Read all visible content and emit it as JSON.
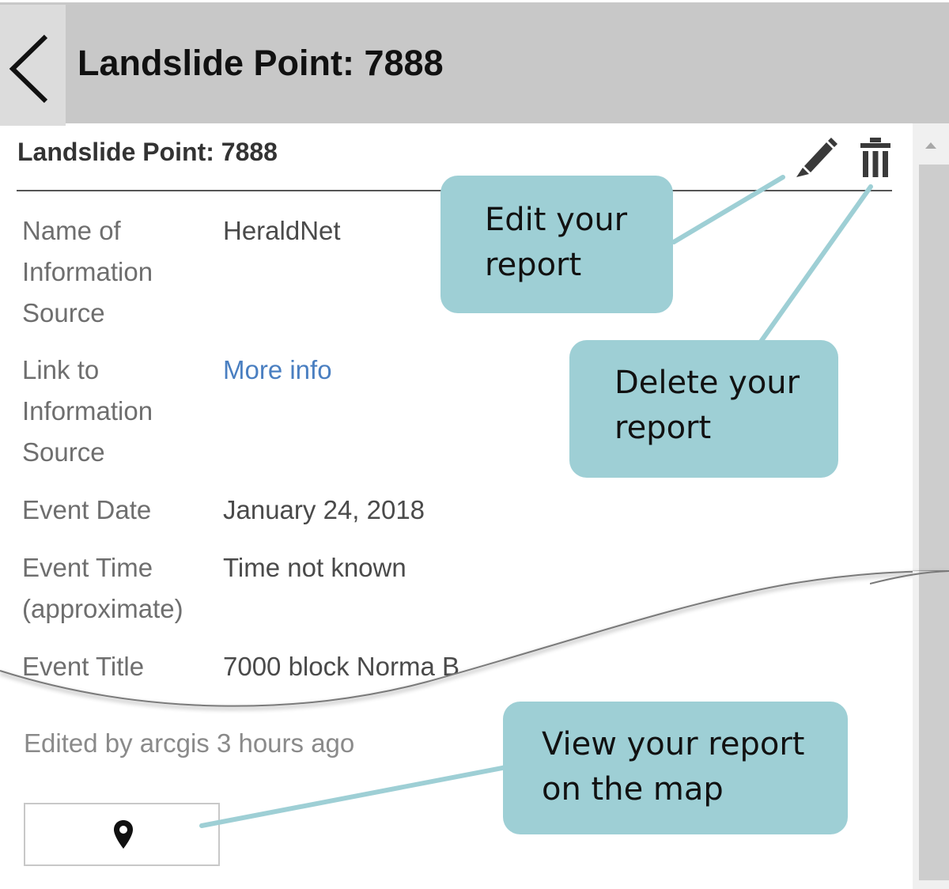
{
  "header": {
    "back_icon": "chevron-left-icon",
    "title": "Landslide Point: 7888"
  },
  "popup": {
    "title": "Landslide Point: 7888",
    "edit_icon": "pencil-icon",
    "delete_icon": "trash-icon",
    "fields": [
      {
        "label": "Name of Information Source",
        "value": "HeraldNet"
      },
      {
        "label": "Link to Information Source",
        "value": "More info"
      },
      {
        "label": "Event Date",
        "value": "January 24, 2018"
      },
      {
        "label": "Event Time (approximate)",
        "value": "Time not known"
      },
      {
        "label": "Event Title",
        "value": "7000 block Norma B"
      }
    ],
    "edited_note": "Edited by arcgis 3 hours ago",
    "zoom_icon": "map-pin-icon"
  },
  "callouts": {
    "edit": [
      "Edit your",
      "report"
    ],
    "delete": [
      "Delete your",
      "report"
    ],
    "view": [
      "View your report",
      "on the map"
    ]
  },
  "colors": {
    "callout_fill": "#9ecfd5",
    "callout_line": "#9ecfd5",
    "header_bg": "#c8c8c8",
    "link": "#4a7fc1"
  }
}
